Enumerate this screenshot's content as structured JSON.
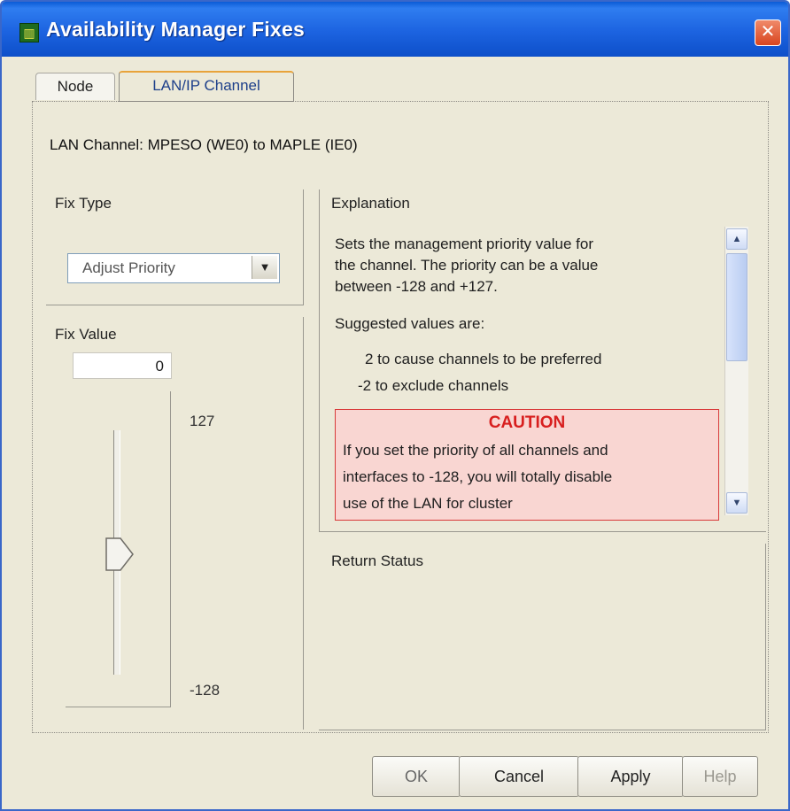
{
  "window": {
    "title": "Availability Manager Fixes",
    "icon_name": "availability-manager-app-icon",
    "close_icon": "close-icon"
  },
  "tabs": [
    {
      "label": "Node",
      "selected": false
    },
    {
      "label": "LAN/IP Channel",
      "selected": true
    }
  ],
  "header": {
    "lan_channel": "LAN Channel: MPESO  (WE0) to MAPLE  (IE0)"
  },
  "fix_type": {
    "label": "Fix Type",
    "selected": "Adjust Priority"
  },
  "fix_value": {
    "label": "Fix Value",
    "value": "0",
    "max_label": "127",
    "min_label": "-128",
    "slider_value": 0,
    "slider_min": -128,
    "slider_max": 127
  },
  "explanation": {
    "label": "Explanation",
    "lines": [
      "Sets the management priority value for",
      "the channel. The priority can be a value",
      "between -128 and +127.",
      "Suggested values are:",
      "2 to cause channels to be preferred",
      "-2 to exclude channels"
    ],
    "caution_title": "CAUTION",
    "caution_lines": [
      "If you set the priority of all channels and",
      "interfaces to -128, you will totally disable",
      "use of the LAN for cluster"
    ]
  },
  "return_status": {
    "label": "Return Status"
  },
  "buttons": {
    "ok": "OK",
    "cancel": "Cancel",
    "apply": "Apply",
    "help": "Help"
  },
  "colors": {
    "title_bar": "#1c63e0",
    "caution_text": "#d81f1f",
    "caution_bg": "#f9d6d2",
    "active_tab_accent": "#e8a33a"
  }
}
